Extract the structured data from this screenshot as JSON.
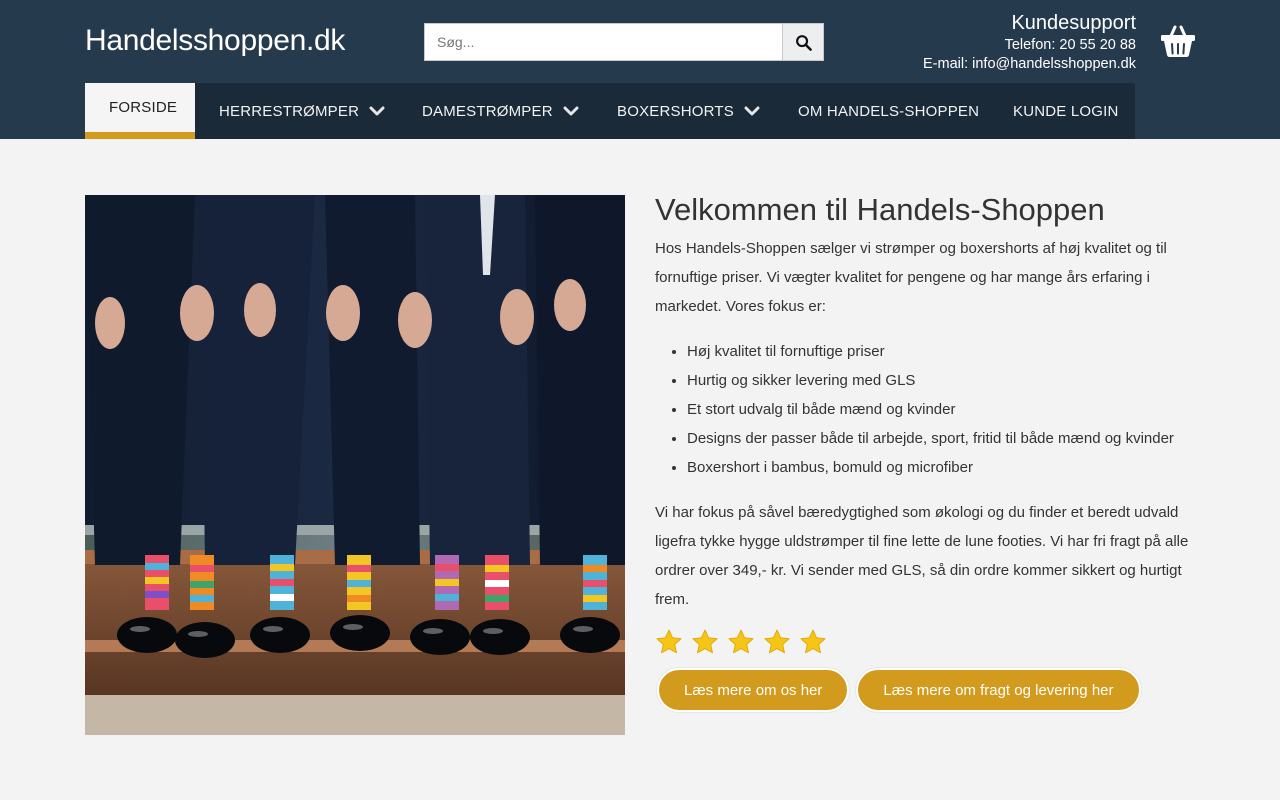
{
  "header": {
    "logo": "Handelsshoppen.dk",
    "search_placeholder": "Søg...",
    "support_title": "Kundesupport",
    "support_phone": "Telefon: 20 55 20 88",
    "support_email": "E-mail: info@handelsshoppen.dk",
    "cart_icon": "basket-icon",
    "search_icon": "search-icon"
  },
  "nav": {
    "items": [
      {
        "label": "FORSIDE",
        "active": true,
        "dropdown": false
      },
      {
        "label": "HERRESTRØMPER",
        "dropdown": true
      },
      {
        "label": "DAMESTRØMPER",
        "dropdown": true
      },
      {
        "label": "BOXERSHORTS",
        "dropdown": true
      },
      {
        "label": "OM HANDELS-SHOPPEN",
        "dropdown": false
      },
      {
        "label": "KUNDE LOGIN",
        "dropdown": false
      }
    ]
  },
  "main": {
    "title": "Velkommen til Handels-Shoppen",
    "intro": "Hos Handels-Shoppen sælger vi strømper og boxershorts af høj kvalitet og til fornuftige priser. Vi vægter kvalitet for pengene og har mange års erfaring i markedet. Vores fokus er:",
    "features": [
      "Høj kvalitet til fornuftige priser",
      "Hurtig og sikker levering med GLS",
      "Et stort udvalg til både mænd og kvinder",
      "Designs der passer både til arbejde, sport, fritid til både mænd og kvinder",
      "Boxershort i bambus, bomuld og microfiber"
    ],
    "body": "Vi har fokus på såvel bæredygtighed som økologi og du finder et beredt udvald ligefra tykke hygge uldstrømper til fine lette de lune footies. Vi har fri fragt på alle ordrer over 349,- kr. Vi sender med GLS, så din ordre kommer sikkert og hurtigt frem.",
    "rating": 5,
    "button_about": "Læs mere om os her",
    "button_shipping": "Læs mere om fragt og levering her"
  },
  "colors": {
    "header_bg": "#263a4d",
    "nav_bg": "#1b2a38",
    "accent": "#d39b1d",
    "page_bg": "#f3f3f3",
    "star": "#f5c518"
  }
}
